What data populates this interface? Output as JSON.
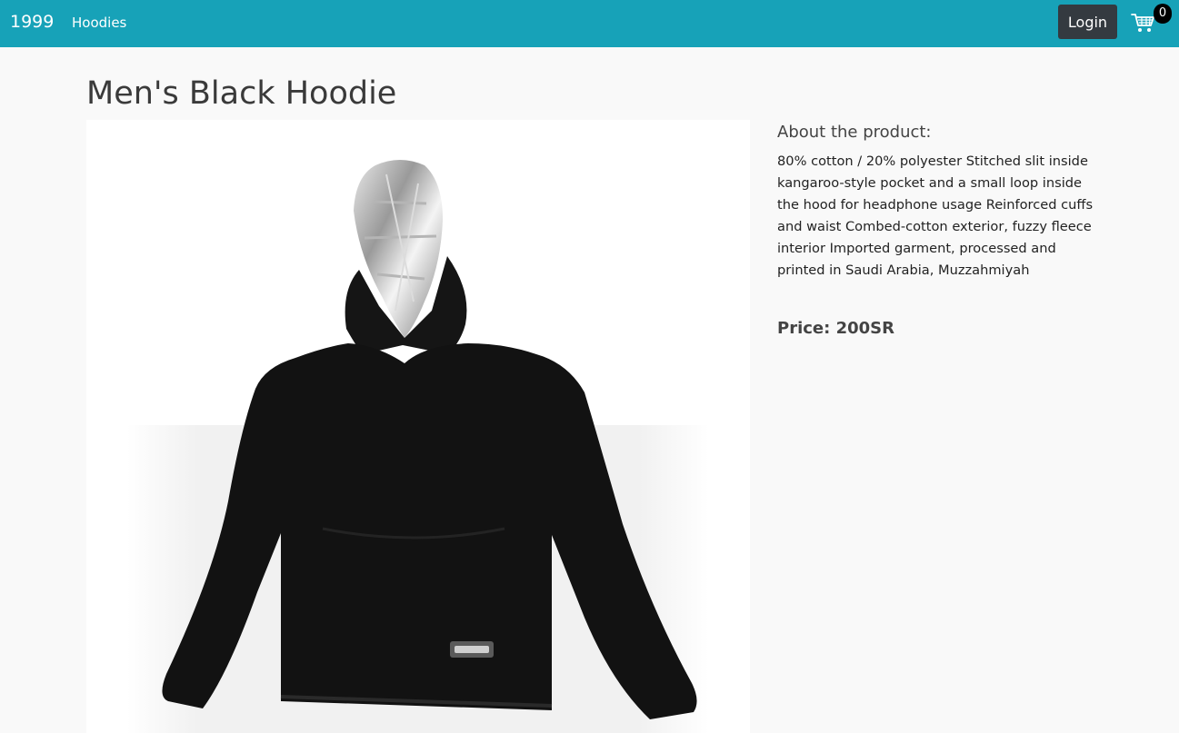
{
  "navbar": {
    "brand": "1999",
    "links": [
      {
        "label": "Hoodies"
      }
    ],
    "login_label": "Login",
    "cart_count": "0",
    "cart_icon": "cart-icon",
    "bg_color": "#17a2b8"
  },
  "product": {
    "title": "Men's Black Hoodie",
    "image_icon": "hoodie-photo",
    "about_heading": "About the product:",
    "description": "80% cotton / 20% polyester Stitched slit inside kangaroo-style pocket and a small loop inside the hood for headphone usage Reinforced cuffs and waist Combed-cotton exterior, fuzzy fleece interior Imported garment, processed and printed in Saudi Arabia, Muzzahmiyah",
    "price": "Price: 200SR"
  }
}
